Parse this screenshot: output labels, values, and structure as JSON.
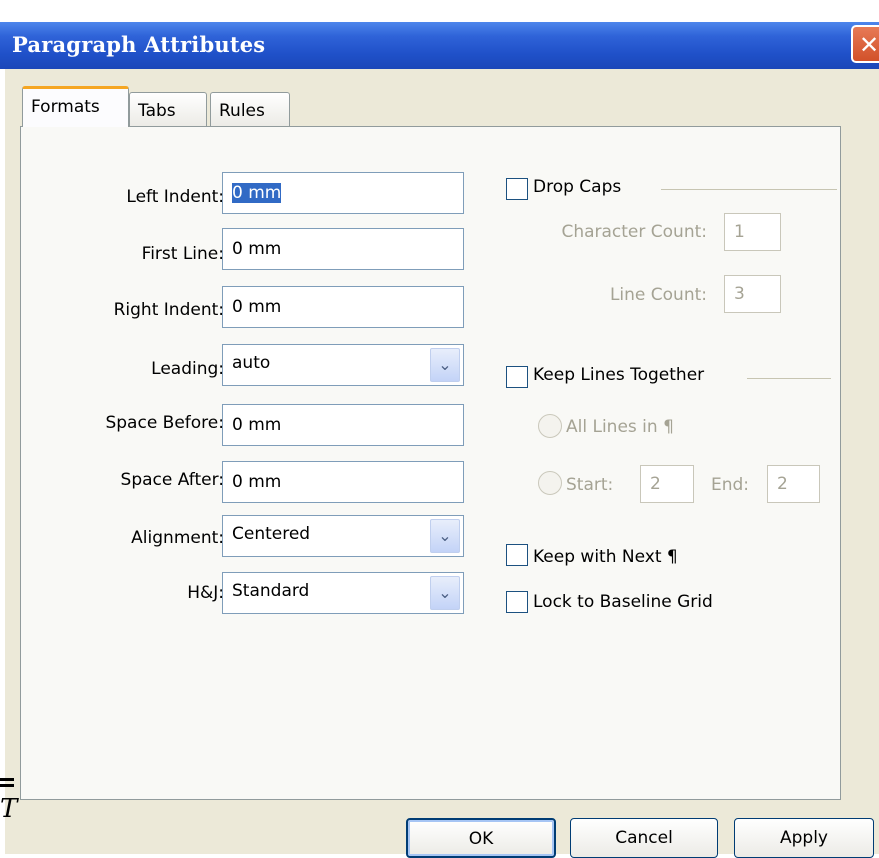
{
  "window": {
    "title": "Paragraph Attributes",
    "close_glyph": "✕"
  },
  "tabs": [
    {
      "label": "Formats",
      "active": true
    },
    {
      "label": "Tabs",
      "active": false
    },
    {
      "label": "Rules",
      "active": false
    }
  ],
  "formats": {
    "left_indent": {
      "label": "Left Indent:",
      "value": "0 mm"
    },
    "first_line": {
      "label": "First Line:",
      "value": "0 mm"
    },
    "right_indent": {
      "label": "Right Indent:",
      "value": "0 mm"
    },
    "leading": {
      "label": "Leading:",
      "value": "auto"
    },
    "space_before": {
      "label": "Space Before:",
      "value": "0 mm"
    },
    "space_after": {
      "label": "Space After:",
      "value": "0 mm"
    },
    "alignment": {
      "label": "Alignment:",
      "value": "Centered"
    },
    "hj": {
      "label": "H&J:",
      "value": "Standard"
    },
    "dropdown_icon": "chevron-down-icon",
    "dropdown_glyph": "⌄"
  },
  "drop_caps": {
    "label": "Drop Caps",
    "checked": false,
    "character_count_label": "Character Count:",
    "character_count": "1",
    "line_count_label": "Line Count:",
    "line_count": "3"
  },
  "keep_lines_together": {
    "label": "Keep Lines Together",
    "checked": false,
    "all_lines_label": "All Lines in ¶",
    "start_label": "Start:",
    "start_value": "2",
    "end_label": "End:",
    "end_value": "2"
  },
  "keep_with_next": {
    "label": "Keep with Next ¶",
    "checked": false
  },
  "lock_to_baseline": {
    "label": "Lock to Baseline Grid",
    "checked": false
  },
  "buttons": {
    "ok": "OK",
    "cancel": "Cancel",
    "apply": "Apply"
  },
  "background_fragment": "T",
  "colors": {
    "titlebar": "#2f63d8",
    "dialog_bg": "#ece9d8",
    "active_tab_accent": "#f5a623",
    "close_button": "#d2512a"
  }
}
